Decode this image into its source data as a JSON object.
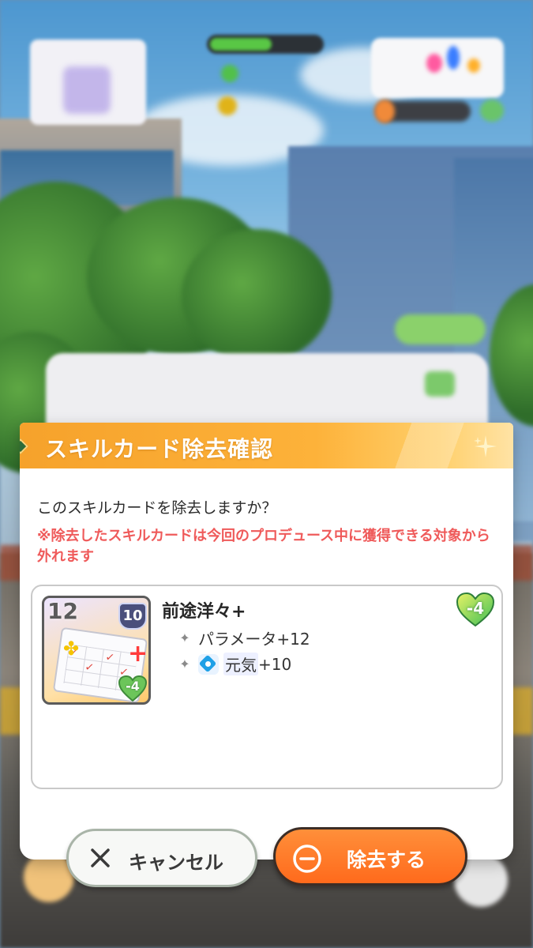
{
  "dialog": {
    "title": "スキルカード除去確認",
    "question": "このスキルカードを除去しますか？",
    "warning": "※除去したスキルカードは今回のプロデュース中に獲得できる対象から外れます"
  },
  "card": {
    "cost": "12",
    "level": "10",
    "art_cost_heart": "-4",
    "name": "前途洋々+",
    "effects": [
      {
        "text": "パラメータ+12"
      },
      {
        "icon_name": "genki-icon",
        "label": "元気",
        "value": "+10"
      }
    ],
    "cost_heart": "-4"
  },
  "buttons": {
    "cancel_label": "キャンセル",
    "remove_label": "除去する"
  },
  "colors": {
    "header_orange": "#f6a22b",
    "warning_red": "#ef5a5a",
    "remove_orange": "#ff7a2a",
    "heart_green": "#6cc55a"
  }
}
